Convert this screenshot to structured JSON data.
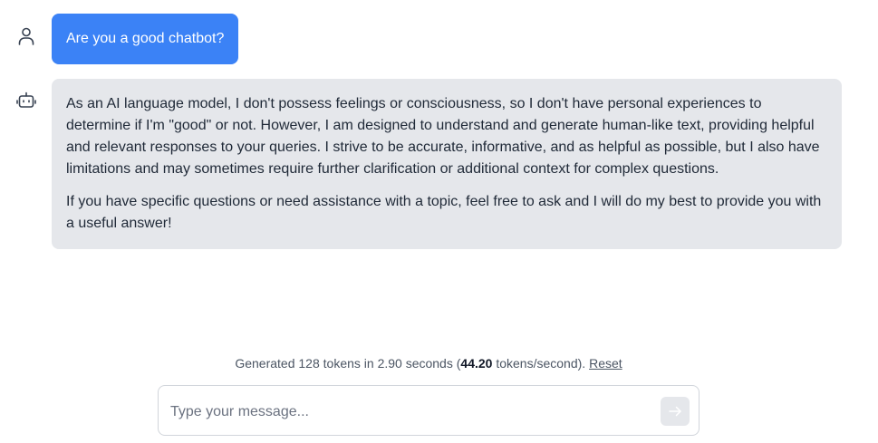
{
  "conversation": {
    "user_message": "Are you a good chatbot?",
    "bot_paragraphs": [
      "As an AI language model, I don't possess feelings or consciousness, so I don't have personal experiences to determine if I'm \"good\" or not. However, I am designed to understand and generate human-like text, providing helpful and relevant responses to your queries. I strive to be accurate, informative, and as helpful as possible, but I also have limitations and may sometimes require further clarification or additional context for complex questions.",
      "If you have specific questions or need assistance with a topic, feel free to ask and I will do my best to provide you with a useful answer!"
    ]
  },
  "status": {
    "prefix": "Generated 128 tokens in 2.90 seconds (",
    "rate": "44.20",
    "suffix": " tokens/second).",
    "reset_label": "Reset"
  },
  "composer": {
    "placeholder": "Type your message...",
    "value": ""
  },
  "icons": {
    "user_avatar": "user-icon",
    "bot_avatar": "robot-icon",
    "send": "arrow-right-icon"
  },
  "colors": {
    "user_bubble": "#3b82f6",
    "bot_bubble": "#e5e7eb",
    "send_button": "#e5e7eb"
  }
}
